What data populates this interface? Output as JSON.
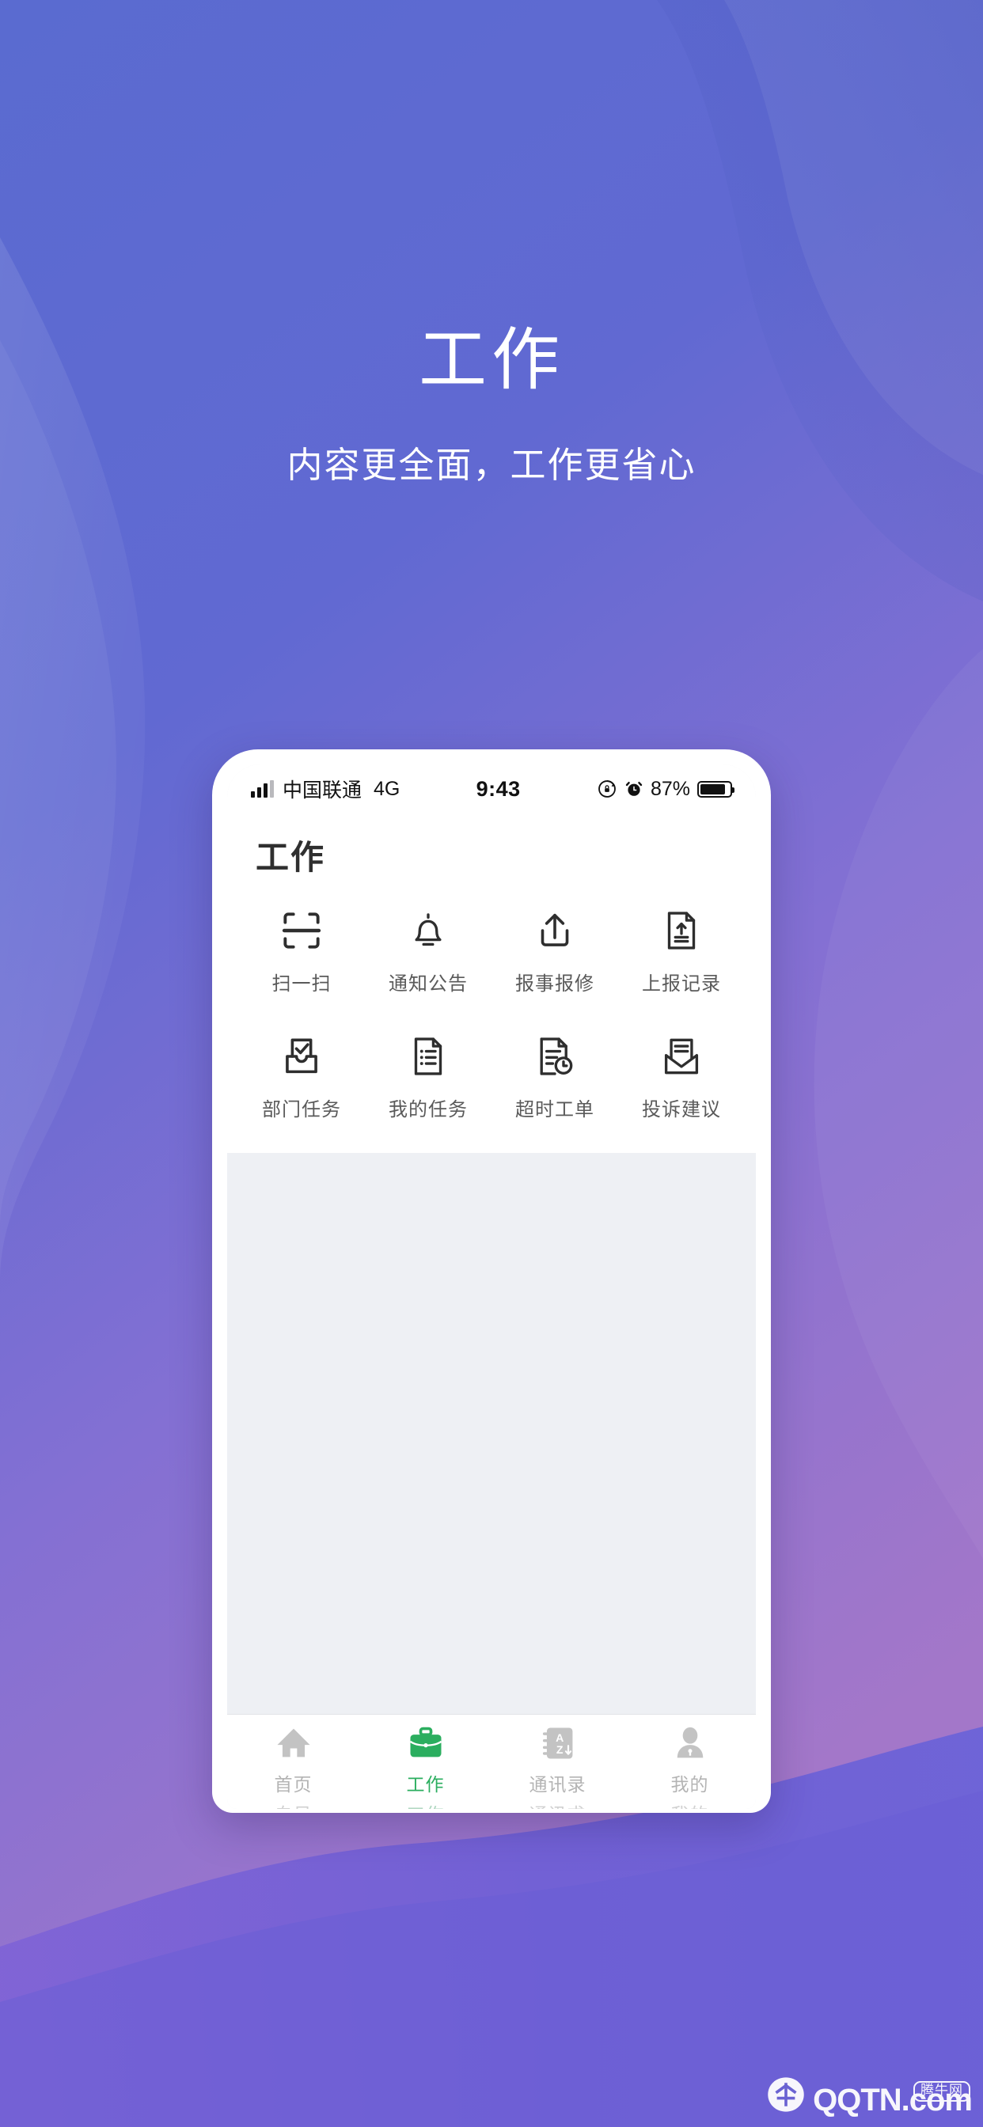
{
  "hero": {
    "title": "工作",
    "subtitle": "内容更全面，工作更省心"
  },
  "colors": {
    "bg_top": "#5869cc",
    "bg_bottom": "#a277c9",
    "accent_green": "#2bae5f",
    "label_gray": "#5a5a5a",
    "tab_inactive": "#b4b4b4",
    "screen_bg": "#eef0f4"
  },
  "phone": {
    "statusbar": {
      "carrier": "中国联通",
      "network": "4G",
      "time": "9:43",
      "battery_percent": "87%",
      "signal_icon": "signal-bars-icon",
      "rotation_lock_icon": "rotation-lock-icon",
      "alarm_icon": "alarm-clock-icon",
      "battery_icon": "battery-icon"
    },
    "app": {
      "title": "工作",
      "grid": [
        {
          "label": "扫一扫",
          "icon": "scan-icon"
        },
        {
          "label": "通知公告",
          "icon": "bell-icon"
        },
        {
          "label": "报事报修",
          "icon": "upload-icon"
        },
        {
          "label": "上报记录",
          "icon": "document-upload-icon"
        },
        {
          "label": "部门任务",
          "icon": "inbox-check-icon"
        },
        {
          "label": "我的任务",
          "icon": "document-list-icon"
        },
        {
          "label": "超时工单",
          "icon": "document-clock-icon"
        },
        {
          "label": "投诉建议",
          "icon": "envelope-letter-icon"
        }
      ]
    },
    "tabbar": [
      {
        "label": "首页",
        "ghost": "自贝",
        "icon": "home-icon",
        "active": false
      },
      {
        "label": "工作",
        "ghost": "工作",
        "icon": "briefcase-icon",
        "active": true
      },
      {
        "label": "通讯录",
        "ghost": "通讯求",
        "icon": "contacts-az-icon",
        "active": false
      },
      {
        "label": "我的",
        "ghost": "我的",
        "icon": "person-icon",
        "active": false
      }
    ]
  },
  "watermark": {
    "brand": "QQTN",
    "suffix": ".com",
    "badge": "腾牛网",
    "logo_icon": "qqtn-logo-icon"
  }
}
